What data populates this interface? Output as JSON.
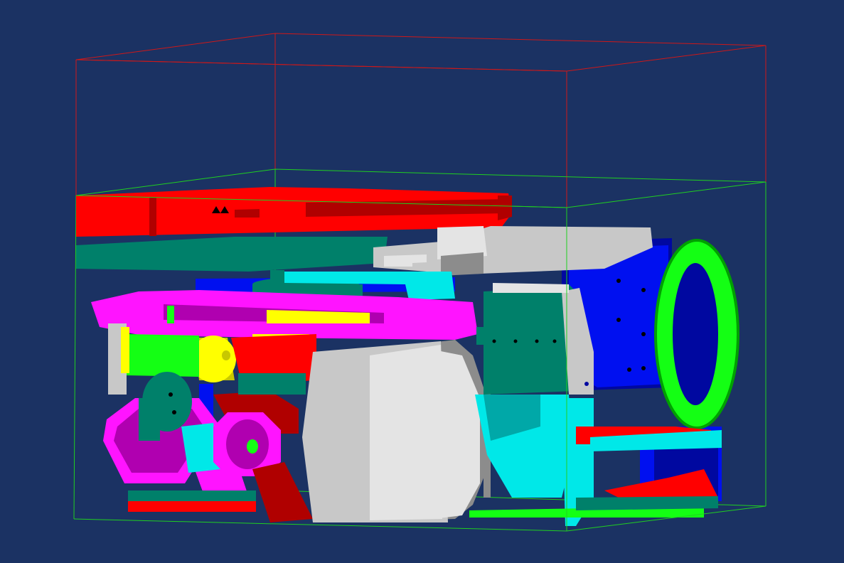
{
  "viewport": {
    "background": "#1b3263"
  },
  "colors": {
    "red": "#ff0000",
    "dark_red": "#b00000",
    "green": "#14ff14",
    "dark_green": "#00a000",
    "teal": "#00806a",
    "cyan": "#00e8e8",
    "dark_cyan": "#00a8a8",
    "blue": "#0010f0",
    "dark_blue": "#0008a0",
    "magenta": "#ff14ff",
    "dark_magenta": "#b000b0",
    "yellow": "#ffff00",
    "dark_yellow": "#c8c800",
    "gray": "#c8c8c8",
    "light_gray": "#e4e4e4",
    "dark_gray": "#8c8c8c",
    "black": "#000000",
    "bbox_outer": "#d01818",
    "bbox_inner": "#20d020"
  },
  "bounding_boxes": [
    {
      "name": "outer-bounding-box",
      "color": "bbox_outer"
    },
    {
      "name": "inner-bounding-box",
      "color": "bbox_inner"
    }
  ],
  "scene": {
    "object": "assembly-model"
  }
}
